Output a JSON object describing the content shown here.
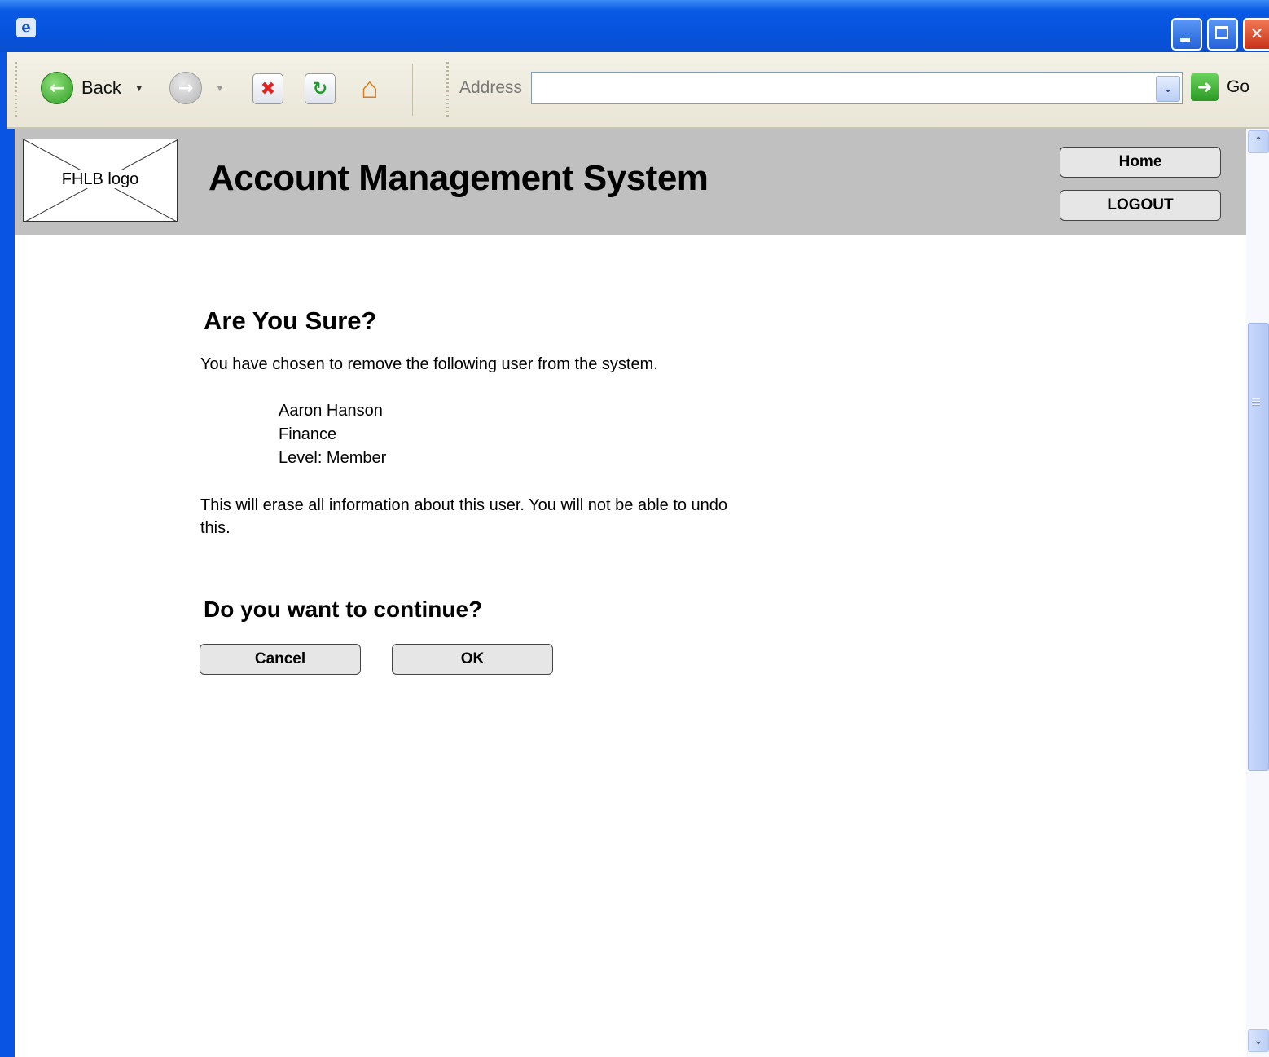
{
  "browser": {
    "toolbar": {
      "back_label": "Back",
      "address_label": "Address",
      "address_value": "",
      "go_label": "Go"
    }
  },
  "page": {
    "header": {
      "logo_text": "FHLB logo",
      "title": "Account Management System",
      "home_label": "Home",
      "logout_label": "LOGOUT"
    },
    "confirm": {
      "heading": "Are You Sure?",
      "intro": "You have chosen to remove the following user from the system.",
      "user": {
        "name": "Aaron Hanson",
        "department": "Finance",
        "level": "Level: Member"
      },
      "warning_line1": "This will erase all information about this user. You will not be able to undo",
      "warning_line2": "this.",
      "question": "Do you want to continue?",
      "cancel_label": "Cancel",
      "ok_label": "OK"
    }
  },
  "colors": {
    "header_bg": "#c0c0c0",
    "window_frame": "#0a54e3",
    "button_bg": "#e6e6e6"
  },
  "icons": [
    "ie-app-icon",
    "minimize-icon",
    "maximize-icon",
    "close-icon",
    "back-arrow-icon",
    "forward-arrow-icon",
    "stop-icon",
    "refresh-icon",
    "home-icon",
    "dropdown-arrow-icon",
    "go-arrow-icon",
    "scroll-up-icon",
    "scroll-down-icon"
  ]
}
